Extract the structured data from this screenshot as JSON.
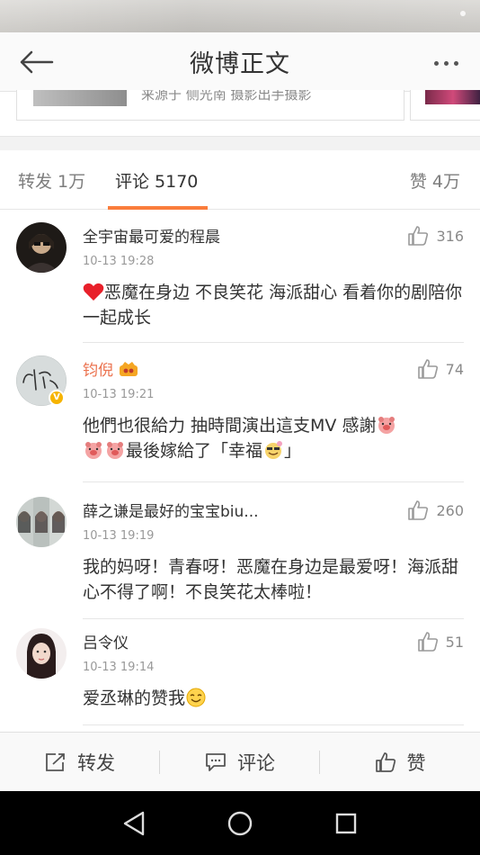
{
  "app": {
    "title": "微博正文"
  },
  "source": {
    "text": "来源于 侧光南 摄影出手摄影"
  },
  "tabs": {
    "repost": "转发 1万",
    "comment": "评论 5170",
    "like": "赞 4万"
  },
  "colors": {
    "accent": "#fa7d3c",
    "vip_name": "#eb7350",
    "badge": "#f6b400"
  },
  "comments": [
    {
      "name": "全宇宙最可爱的程晨",
      "time": "10-13 19:28",
      "text": "恶魔在身边 不良笑花 海派甜心 看着你的剧陪你一起成长",
      "likes": "316",
      "lead_icon": "red-heart-emoji"
    },
    {
      "name": "钧倪",
      "time": "10-13 19:21",
      "text_line1": "他們也很給力 抽時間演出這支MV 感謝",
      "text_line2": "最後嫁給了「幸福",
      "text_end": "」",
      "likes": "74",
      "verified": true,
      "emoji_icon": "pig-blush-emoji"
    },
    {
      "name": "薛之谦是最好的宝宝biu...",
      "time": "10-13 19:19",
      "text": "我的妈呀！青春呀！恶魔在身边是最爱呀！海派甜心不得了啊！不良笑花太棒啦！",
      "likes": "260"
    },
    {
      "name": "吕令仪",
      "time": "10-13 19:14",
      "text": "爱丞琳的赞我",
      "likes": "51",
      "trail_icon": "smile-emoji"
    }
  ],
  "bottom_bar": {
    "repost": "转发",
    "comment": "评论",
    "like": "赞"
  }
}
